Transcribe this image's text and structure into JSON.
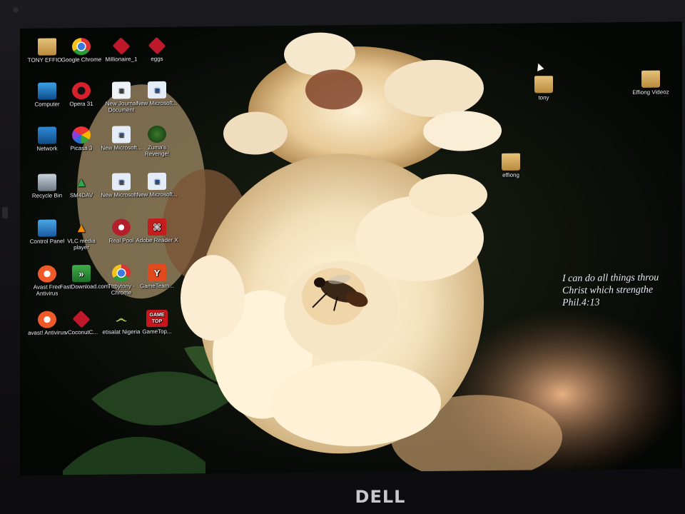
{
  "desktop": {
    "icons": [
      {
        "label": "TONY EFFIO...",
        "icon": "folder-icon"
      },
      {
        "label": "Google Chrome",
        "icon": "chrome-icon"
      },
      {
        "label": "Millionaire_1",
        "icon": "game-icon"
      },
      {
        "label": "eggs",
        "icon": "game-icon"
      },
      {
        "label": "Computer",
        "icon": "computer-icon"
      },
      {
        "label": "Opera 31",
        "icon": "opera-icon"
      },
      {
        "label": "New Journal Document",
        "icon": "journal-icon"
      },
      {
        "label": "New Microsoft...",
        "icon": "word-icon"
      },
      {
        "label": "Network",
        "icon": "network-icon"
      },
      {
        "label": "Picasa 3",
        "icon": "picasa-icon"
      },
      {
        "label": "New Microsoft...",
        "icon": "word-icon"
      },
      {
        "label": "Zuma's Revenge!",
        "icon": "zuma-icon"
      },
      {
        "label": "Recycle Bin",
        "icon": "recycle-bin-icon"
      },
      {
        "label": "SM4DAV",
        "icon": "sm4dav-icon"
      },
      {
        "label": "New Microsoft...",
        "icon": "word-icon"
      },
      {
        "label": "New Microsoft...",
        "icon": "word-icon"
      },
      {
        "label": "Control Panel",
        "icon": "control-panel-icon"
      },
      {
        "label": "VLC media player",
        "icon": "vlc-icon"
      },
      {
        "label": "Real Pool",
        "icon": "pool-icon"
      },
      {
        "label": "Adobe Reader X",
        "icon": "adobe-reader-icon"
      },
      {
        "label": "Avast Free Antivirus",
        "icon": "avast-icon"
      },
      {
        "label": "FastDownload.com",
        "icon": "fastdownload-icon"
      },
      {
        "label": "Tttbytony - Chrome",
        "icon": "chrome-icon"
      },
      {
        "label": "GameTeam...",
        "icon": "gameteam-icon"
      },
      {
        "label": "avast! Antivirus",
        "icon": "avast-icon"
      },
      {
        "label": "vCoconutC...",
        "icon": "game-icon"
      },
      {
        "label": "etisalat Nigeria",
        "icon": "etisalat-icon"
      },
      {
        "label": "GameTop...",
        "icon": "gametop-icon"
      }
    ],
    "right_icons": [
      {
        "label": "tony",
        "icon": "folder-icon"
      },
      {
        "label": "Effiong Videoz",
        "icon": "folder-icon"
      },
      {
        "label": "effiong",
        "icon": "folder-icon"
      }
    ],
    "gametop_badge": "GAME TOP",
    "quote": {
      "line1": "I can do all things throu",
      "line2": "Christ which strengthe",
      "line3": "Phil.4:13"
    }
  },
  "bezel": {
    "brand": "DELL"
  }
}
